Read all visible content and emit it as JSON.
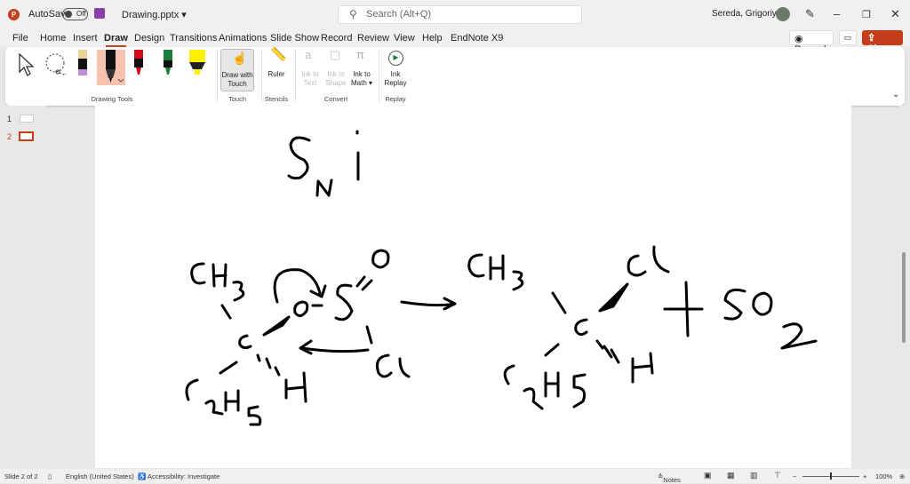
{
  "titlebar": {
    "autosave": "AutoSave",
    "toggle": "Off",
    "filename": "Drawing.pptx ▾",
    "search_placeholder": "Search (Alt+Q)",
    "user": "Sereda, Grigoriy A"
  },
  "menu": [
    "File",
    "Home",
    "Insert",
    "Draw",
    "Design",
    "Transitions",
    "Animations",
    "Slide Show",
    "Record",
    "Review",
    "View",
    "Help",
    "EndNote X9"
  ],
  "actions": {
    "record": "Record",
    "share": "Share"
  },
  "ribbon": {
    "draw_with_touch": "Draw with Touch",
    "ruler": "Ruler",
    "ink_to_text": "Ink to Text",
    "ink_to_shape": "Ink to Shape",
    "ink_to_math": "Ink to Math ▾",
    "ink_replay": "Ink Replay",
    "groups": [
      "Drawing Tools",
      "Touch",
      "Stencils",
      "Convert",
      "Replay"
    ]
  },
  "thumbs": [
    "1",
    "2"
  ],
  "status": {
    "slide": "Slide 2 of 2",
    "language": "English (United States)",
    "accessibility": "Accessibility: Investigate",
    "notes": "Notes",
    "zoom": "100%"
  },
  "colors": {
    "accent": "#c43e1c",
    "pen_black": "#000000",
    "pen_red": "#d10e1e",
    "pen_green": "#1a7f3c",
    "highlighter": "#ffef00"
  }
}
